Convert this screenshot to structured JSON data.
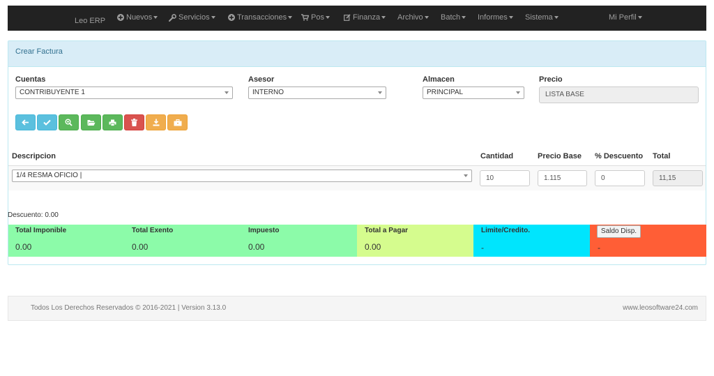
{
  "navbar": {
    "brand": "Leo ERP",
    "items": [
      {
        "label": "Nuevos",
        "icon": "plus-circle-icon"
      },
      {
        "label": "Servicios",
        "icon": "wrench-icon"
      },
      {
        "label": "Transacciones",
        "icon": "plus-circle-icon"
      },
      {
        "label": "Pos",
        "icon": "shopping-cart-icon"
      },
      {
        "label": "Finanza",
        "icon": "edit-icon"
      },
      {
        "label": "Archivo"
      },
      {
        "label": "Batch"
      },
      {
        "label": "Informes"
      },
      {
        "label": "Sistema"
      },
      {
        "label": "Mi Perfil"
      }
    ]
  },
  "panel": {
    "title": "Crear Factura"
  },
  "form": {
    "cuentas": {
      "label": "Cuentas",
      "value": "CONTRIBUYENTE 1"
    },
    "asesor": {
      "label": "Asesor",
      "value": "INTERNO"
    },
    "almacen": {
      "label": "Almacen",
      "value": "PRINCIPAL"
    },
    "precio": {
      "label": "Precio",
      "value": "LISTA BASE"
    }
  },
  "toolbar": [
    {
      "icon": "arrow-left-icon",
      "color": "#5bc0de"
    },
    {
      "icon": "check-icon",
      "color": "#5bc0de"
    },
    {
      "icon": "zoom-in-icon",
      "color": "#5cb85c"
    },
    {
      "icon": "folder-open-icon",
      "color": "#5cb85c"
    },
    {
      "icon": "print-icon",
      "color": "#5cb85c"
    },
    {
      "icon": "trash-icon",
      "color": "#d9534f"
    },
    {
      "icon": "download-icon",
      "color": "#f0ad4e"
    },
    {
      "icon": "briefcase-icon",
      "color": "#f0ad4e"
    }
  ],
  "table": {
    "headers": {
      "descripcion": "Descripcion",
      "cantidad": "Cantidad",
      "precio_base": "Precio Base",
      "descuento": "% Descuento",
      "total": "Total"
    },
    "row": {
      "descripcion": "1/4 RESMA OFICIO |",
      "cantidad": "10",
      "precio_base": "1.115",
      "descuento": "0",
      "total": "11,15"
    }
  },
  "descuento_text": "Descuento: 0.00",
  "summary": {
    "total_imponible": {
      "title": "Total Imponible",
      "value": "0.00"
    },
    "total_exento": {
      "title": "Total Exento",
      "value": "0.00"
    },
    "impuesto": {
      "title": "Impuesto",
      "value": "0.00"
    },
    "total_pagar": {
      "title": "Total a Pagar",
      "value": "0.00"
    },
    "limite_credito": {
      "title": "Limite/Credito.",
      "value": "-"
    },
    "saldo_disp": {
      "button": "Saldo Disp.",
      "value": "-"
    },
    "colors": {
      "green": "#8cfba9",
      "yellow": "#d5fc8e",
      "cyan": "#00e5fd",
      "orange": "#ff5e36"
    }
  },
  "footer": {
    "copyright": "Todos Los Derechos Reservados © 2016-2021 | Version 3.13.0",
    "website": "www.leosoftware24.com"
  }
}
